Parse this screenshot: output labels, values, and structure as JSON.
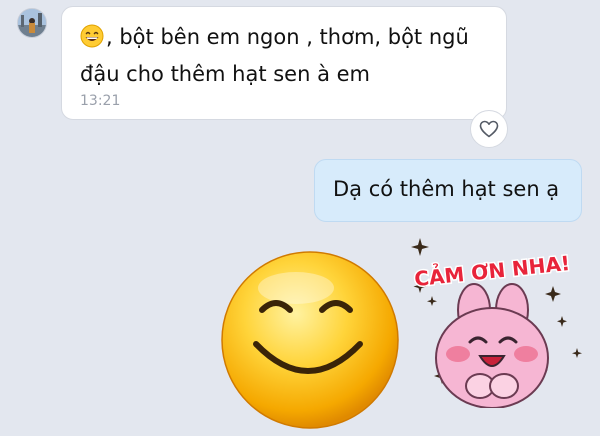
{
  "conversation": {
    "incoming": {
      "emoji": "grinning-face-icon",
      "text": ", bột bên em ngon , thơm, bột ngũ đậu cho thêm hạt sen à em",
      "time": "13:21",
      "reaction_icon": "heart-outline-icon"
    },
    "outgoing": {
      "text": "Dạ có thêm hạt sen ạ"
    },
    "emoji_message": {
      "icon": "big-smiley-emoji-icon"
    },
    "sticker": {
      "icon": "pink-bunny-sticker-icon",
      "text": "CẢM ƠN NHA!"
    }
  },
  "colors": {
    "background": "#e3e7ef",
    "incoming_bubble": "#ffffff",
    "outgoing_bubble": "#d7ebfb",
    "sticker_text": "#e8243a",
    "sticker_pink": "#f6b6d3"
  }
}
